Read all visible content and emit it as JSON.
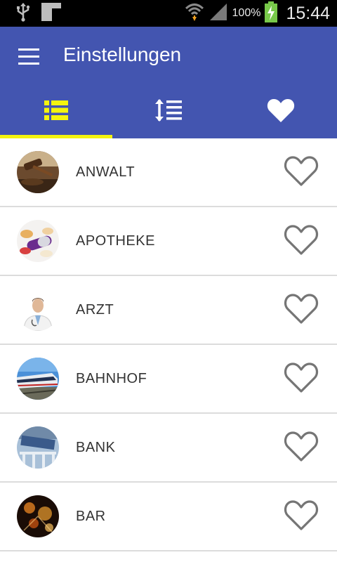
{
  "status_bar": {
    "battery_percent": "100%",
    "time": "15:44",
    "icons": [
      "usb-icon",
      "notification-icon",
      "wifi-icon",
      "signal-icon",
      "battery-charging-icon"
    ]
  },
  "app_bar": {
    "title": "Einstellungen",
    "menu_icon": "hamburger-menu-icon"
  },
  "tabs": [
    {
      "name": "list",
      "icon": "list-icon",
      "selected": true,
      "color": "#f4f40e"
    },
    {
      "name": "sort",
      "icon": "sort-icon",
      "selected": false,
      "color": "#ffffff"
    },
    {
      "name": "favorites",
      "icon": "heart-icon",
      "selected": false,
      "color": "#ffffff"
    }
  ],
  "categories": [
    {
      "label": "ANWALT",
      "image": "gavel-photo",
      "favorite": false
    },
    {
      "label": "APOTHEKE",
      "image": "pills-photo",
      "favorite": false
    },
    {
      "label": "ARZT",
      "image": "doctor-photo",
      "favorite": false
    },
    {
      "label": "BAHNHOF",
      "image": "train-photo",
      "favorite": false
    },
    {
      "label": "BANK",
      "image": "bank-photo",
      "favorite": false
    },
    {
      "label": "BAR",
      "image": "bar-photo",
      "favorite": false
    }
  ],
  "colors": {
    "primary": "#4355b0",
    "accent": "#f4f40e",
    "divider": "#dcdcdc",
    "heart_outline": "#757575"
  }
}
